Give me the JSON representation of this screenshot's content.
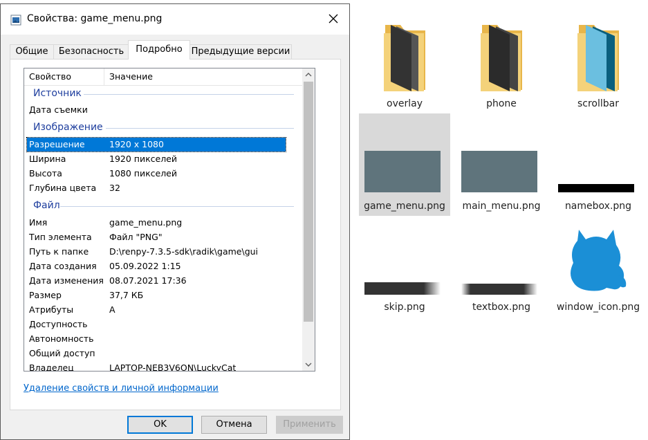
{
  "dialog": {
    "title": "Свойства: game_menu.png",
    "tabs": [
      "Общие",
      "Безопасность",
      "Подробно",
      "Предыдущие версии"
    ],
    "active_tab": "Подробно",
    "columns": {
      "property": "Свойство",
      "value": "Значение"
    },
    "groups": {
      "source": "Источник",
      "image": "Изображение",
      "file": "Файл"
    },
    "rows": {
      "date_taken": {
        "prop": "Дата съемки",
        "val": ""
      },
      "resolution": {
        "prop": "Разрешение",
        "val": "1920 x 1080"
      },
      "width": {
        "prop": "Ширина",
        "val": "1920 пикселей"
      },
      "height": {
        "prop": "Высота",
        "val": "1080 пикселей"
      },
      "bit_depth": {
        "prop": "Глубина цвета",
        "val": "32"
      },
      "name": {
        "prop": "Имя",
        "val": "game_menu.png"
      },
      "item_type": {
        "prop": "Тип элемента",
        "val": "Файл \"PNG\""
      },
      "folder_path": {
        "prop": "Путь к папке",
        "val": "D:\\renpy-7.3.5-sdk\\radik\\game\\gui"
      },
      "date_created": {
        "prop": "Дата создания",
        "val": "05.09.2022 1:15"
      },
      "date_modified": {
        "prop": "Дата изменения",
        "val": "08.07.2021 17:36"
      },
      "size": {
        "prop": "Размер",
        "val": "37,7 КБ"
      },
      "attributes": {
        "prop": "Атрибуты",
        "val": "A"
      },
      "availability": {
        "prop": "Доступность",
        "val": ""
      },
      "offline": {
        "prop": "Автономность",
        "val": ""
      },
      "shared": {
        "prop": "Общий доступ",
        "val": ""
      },
      "owner": {
        "prop": "Владелец",
        "val": "LAPTOP-NEB3V6ON\\LuckyCat"
      }
    },
    "remove_link": "Удаление свойств и личной информации",
    "buttons": {
      "ok": "OK",
      "cancel": "Отмена",
      "apply": "Применить"
    }
  },
  "explorer": {
    "items": [
      {
        "label": "overlay",
        "icon": "folder-icon"
      },
      {
        "label": "phone",
        "icon": "folder-icon"
      },
      {
        "label": "scrollbar",
        "icon": "folder-icon"
      },
      {
        "label": "game_menu.png",
        "icon": "image-thumbnail",
        "selected": true
      },
      {
        "label": "main_menu.png",
        "icon": "image-thumbnail"
      },
      {
        "label": "namebox.png",
        "icon": "image-thumbnail"
      },
      {
        "label": "skip.png",
        "icon": "image-thumbnail"
      },
      {
        "label": "textbox.png",
        "icon": "image-thumbnail"
      },
      {
        "label": "window_icon.png",
        "icon": "image-thumbnail"
      }
    ]
  },
  "colors": {
    "selection": "#0078d7",
    "group_header": "#1e3e9e",
    "link": "#0066cc",
    "thumb_gray": "#5f747c",
    "window_icon_blue": "#1b8fd6",
    "scrollbar_folder": "#6bbfe0"
  }
}
